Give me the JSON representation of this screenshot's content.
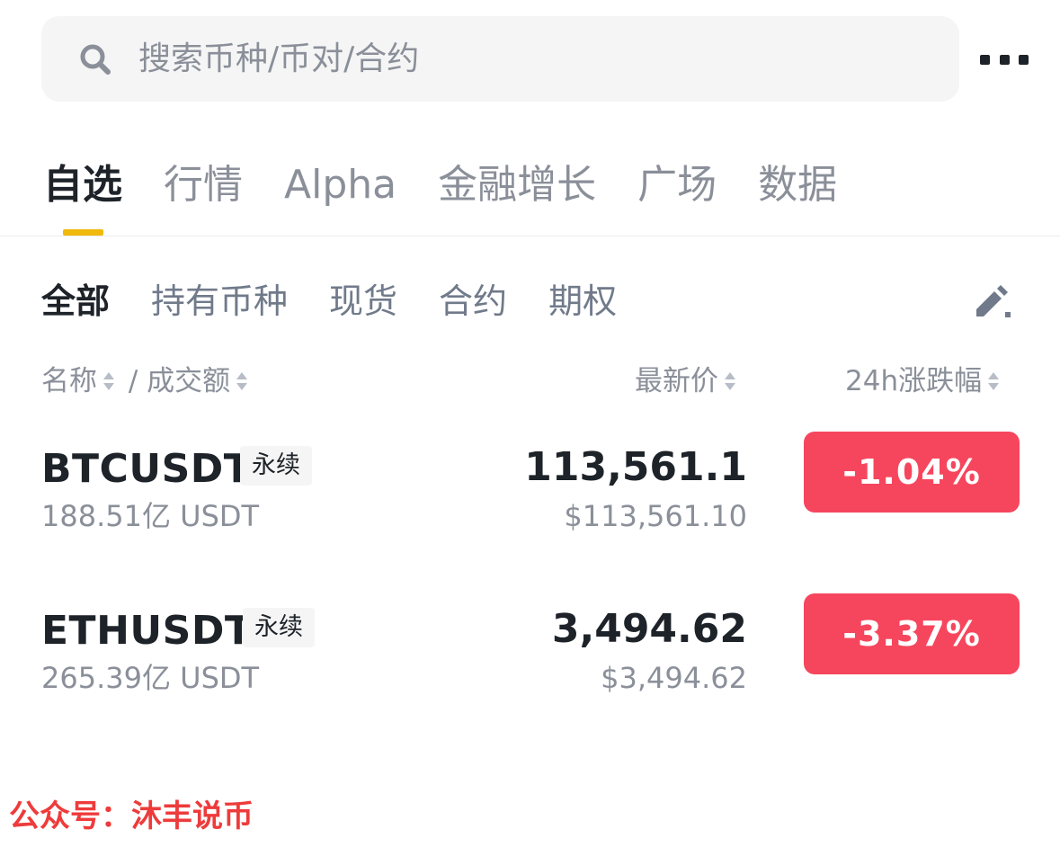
{
  "search": {
    "placeholder": "搜索币种/币对/合约",
    "value": ""
  },
  "tabs": [
    {
      "label": "自选",
      "active": true
    },
    {
      "label": "行情"
    },
    {
      "label": "Alpha"
    },
    {
      "label": "金融增长"
    },
    {
      "label": "广场"
    },
    {
      "label": "数据"
    }
  ],
  "subtabs": [
    {
      "label": "全部",
      "active": true
    },
    {
      "label": "持有币种"
    },
    {
      "label": "现货"
    },
    {
      "label": "合约"
    },
    {
      "label": "期权"
    }
  ],
  "columns": {
    "name": "名称",
    "separator": " / ",
    "volume": "成交额",
    "price": "最新价",
    "change": "24h涨跌幅"
  },
  "rows": [
    {
      "symbol": "BTCUSDT",
      "tag": "永续",
      "volume": "188.51亿 USDT",
      "price": "113,561.1",
      "usd_price": "$113,561.10",
      "change": "-1.04%"
    },
    {
      "symbol": "ETHUSDT",
      "tag": "永续",
      "volume": "265.39亿 USDT",
      "price": "3,494.62",
      "usd_price": "$3,494.62",
      "change": "-3.37%"
    }
  ],
  "watermark": "公众号：沐丰说币",
  "colors": {
    "accent": "#f0b90b",
    "negative": "#f6465d",
    "text_primary": "#1e2329",
    "text_secondary": "#8a8f99",
    "watermark": "#ee3b3b"
  },
  "icons": [
    "search-icon",
    "more-icon",
    "edit-icon",
    "sort-icon"
  ]
}
